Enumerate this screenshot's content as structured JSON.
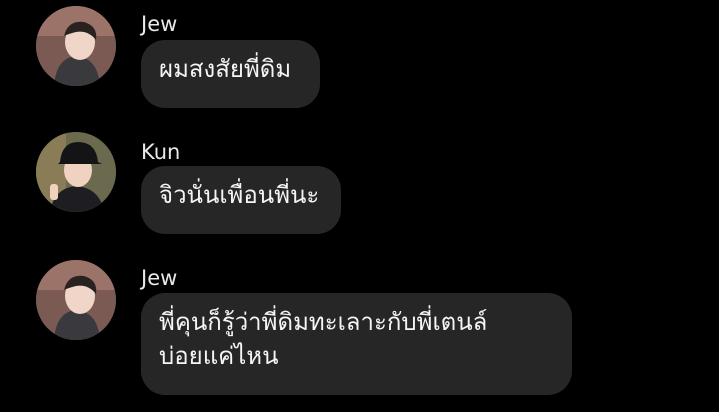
{
  "messages": [
    {
      "sender": "Jew",
      "avatar_icon": "user-avatar-photo",
      "lines": [
        "ผมสงสัยพี่ดิม"
      ]
    },
    {
      "sender": "Kun",
      "avatar_icon": "user-avatar-photo",
      "lines": [
        "จิวนั่นเพื่อนพี่นะ"
      ]
    },
    {
      "sender": "Jew",
      "avatar_icon": "user-avatar-photo",
      "lines": [
        "พี่คุนก็รู้ว่าพี่ดิมทะเลาะกับพี่เตนล์",
        "บ่อยแค่ไหน"
      ]
    }
  ],
  "colors": {
    "background": "#000000",
    "bubble": "#262626",
    "text": "#f5f5f5",
    "sender": "#e9e9e9"
  }
}
